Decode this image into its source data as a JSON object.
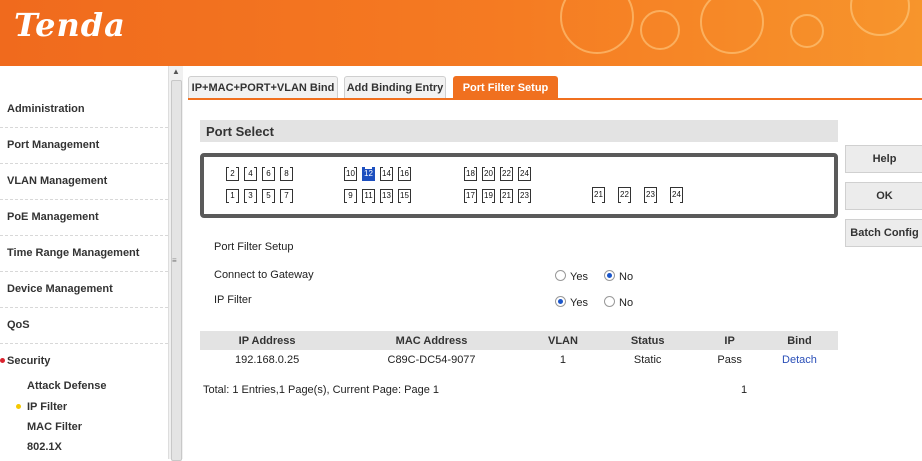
{
  "brand": {
    "logo": "Tenda",
    "accent": "#f0701f",
    "selected_port_color": "#1d4fbf"
  },
  "sidebar": {
    "items": [
      {
        "label": "Administration"
      },
      {
        "label": "Port Management"
      },
      {
        "label": "VLAN Management"
      },
      {
        "label": "PoE Management"
      },
      {
        "label": "Time Range Management"
      },
      {
        "label": "Device Management"
      },
      {
        "label": "QoS"
      },
      {
        "label": "Security",
        "active": true
      }
    ],
    "subitems": [
      {
        "label": "Attack Defense"
      },
      {
        "label": "IP Filter",
        "active": true
      },
      {
        "label": "MAC Filter"
      },
      {
        "label": "802.1X"
      }
    ]
  },
  "tabs": [
    {
      "label": "IP+MAC+PORT+VLAN Bind"
    },
    {
      "label": "Add Binding Entry"
    },
    {
      "label": "Port Filter Setup",
      "active": true
    }
  ],
  "port_select": {
    "title": "Port Select",
    "top_row": [
      "2",
      "4",
      "6",
      "8",
      "10",
      "12",
      "14",
      "16",
      "18",
      "20",
      "22",
      "24"
    ],
    "bottom_row": [
      "1",
      "3",
      "5",
      "7",
      "9",
      "11",
      "13",
      "15",
      "17",
      "19",
      "21",
      "23"
    ],
    "sfp": [
      "21",
      "22",
      "23",
      "24"
    ],
    "selected": "12"
  },
  "side_buttons": {
    "help": "Help",
    "ok": "OK",
    "batch": "Batch Config"
  },
  "form": {
    "heading": "Port Filter Setup",
    "gateway_label": "Connect to Gateway",
    "gateway_value": "No",
    "filter_label": "IP Filter",
    "filter_value": "Yes",
    "yes": "Yes",
    "no": "No"
  },
  "table": {
    "headers": [
      "IP Address",
      "MAC Address",
      "VLAN",
      "Status",
      "IP",
      "Bind"
    ],
    "rows": [
      [
        "192.168.0.25",
        "C89C-DC54-9077",
        "1",
        "Static",
        "Pass",
        "Detach"
      ]
    ]
  },
  "footer": {
    "summary": "Total: 1 Entries,1 Page(s), Current Page: Page 1",
    "page": "1"
  }
}
